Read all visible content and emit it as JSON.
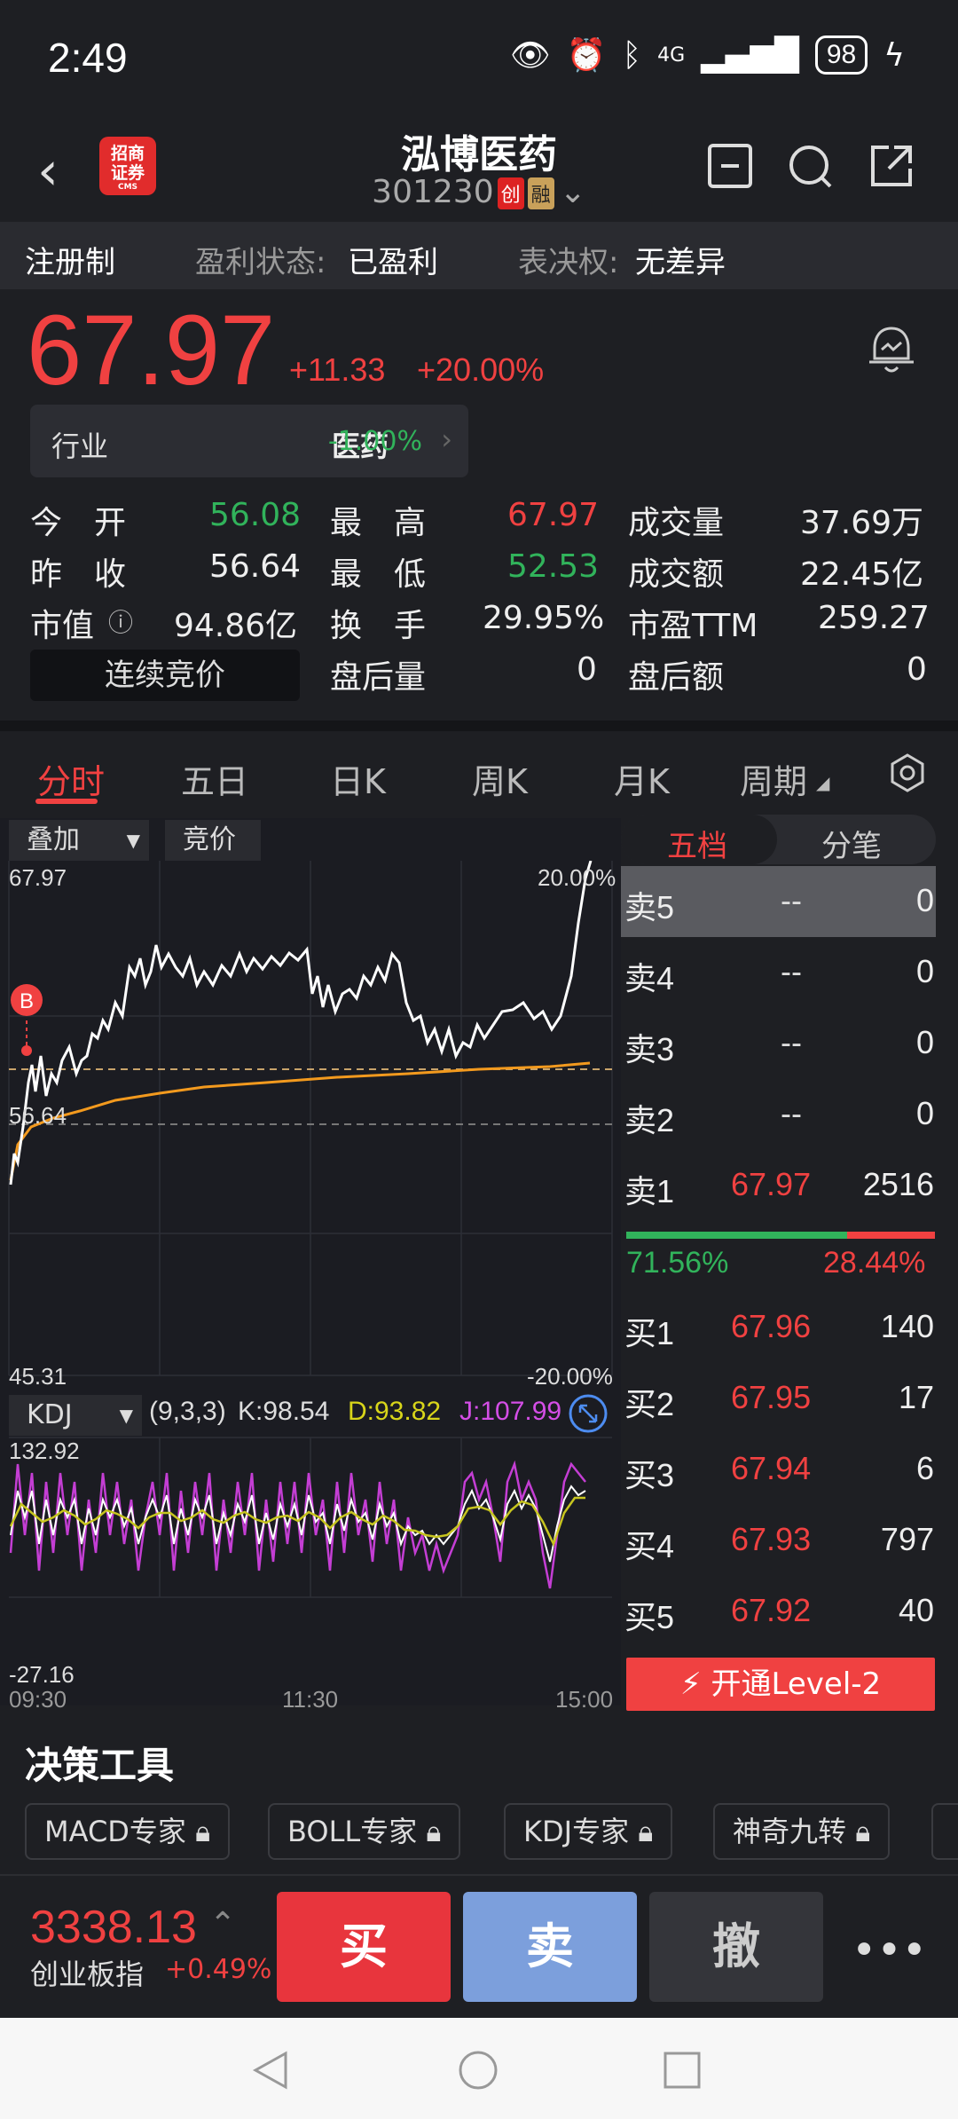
{
  "status": {
    "time": "2:49",
    "battery": "98",
    "network": "4G"
  },
  "header": {
    "name": "泓博医药",
    "code": "301230",
    "tag_cy": "创",
    "tag_rz": "融",
    "logo_line1": "招商",
    "logo_line2": "证券",
    "logo_line3": "CMS"
  },
  "strip": {
    "reg": "注册制",
    "profit_label": "盈利状态:",
    "profit_value": "已盈利",
    "vote_label": "表决权:",
    "vote_value": "无差异"
  },
  "quote": {
    "price": "67.97",
    "change": "+11.33",
    "change_pct": "+20.00%"
  },
  "industry": {
    "label": "行业",
    "name": "医药",
    "pct": "-1.00%"
  },
  "stats": {
    "open_label": "今　开",
    "open": "56.08",
    "high_label": "最　高",
    "high": "67.97",
    "vol_label": "成交量",
    "vol": "37.69万",
    "prev_label": "昨　收",
    "prev": "56.64",
    "low_label": "最　低",
    "low": "52.53",
    "amt_label": "成交额",
    "amt": "22.45亿",
    "mcap_label": "市值",
    "mcap": "94.86亿",
    "turn_label": "换　手",
    "turn": "29.95%",
    "pe_label": "市盈TTM",
    "pe": "259.27",
    "auction": "连续竞价",
    "after_vol_label": "盘后量",
    "after_vol": "0",
    "after_amt_label": "盘后额",
    "after_amt": "0"
  },
  "tabs": [
    "分时",
    "五日",
    "日K",
    "周K",
    "月K",
    "周期"
  ],
  "chart": {
    "overlay": "叠加",
    "auction": "竞价",
    "top_price": "67.97",
    "top_pct": "20.00%",
    "mid_price": "56.64",
    "bottom_price": "45.31",
    "bottom_pct": "-20.00%",
    "kdj_label": "KDJ",
    "kdj_params": "(9,3,3)",
    "k": "K:98.54",
    "d": "D:93.82",
    "j": "J:107.99",
    "kdj_max": "132.92",
    "kdj_min": "-27.16",
    "time_start": "09:30",
    "time_mid": "11:30",
    "time_end": "15:00",
    "buy_marker": "B"
  },
  "orderbook": {
    "tab1": "五档",
    "tab2": "分笔",
    "asks": [
      {
        "label": "卖5",
        "price": "--",
        "vol": "0"
      },
      {
        "label": "卖4",
        "price": "--",
        "vol": "0"
      },
      {
        "label": "卖3",
        "price": "--",
        "vol": "0"
      },
      {
        "label": "卖2",
        "price": "--",
        "vol": "0"
      },
      {
        "label": "卖1",
        "price": "67.97",
        "vol": "2516"
      }
    ],
    "buy_ratio": "71.56%",
    "sell_ratio": "28.44%",
    "bids": [
      {
        "label": "买1",
        "price": "67.96",
        "vol": "140"
      },
      {
        "label": "买2",
        "price": "67.95",
        "vol": "17"
      },
      {
        "label": "买3",
        "price": "67.94",
        "vol": "6"
      },
      {
        "label": "买4",
        "price": "67.93",
        "vol": "797"
      },
      {
        "label": "买5",
        "price": "67.92",
        "vol": "40"
      }
    ],
    "level2": "开通Level-2"
  },
  "tools": {
    "title": "决策工具",
    "items": [
      "MACD专家",
      "BOLL专家",
      "KDJ专家",
      "神奇九转"
    ]
  },
  "trade": {
    "index_value": "3338.13",
    "index_name": "创业板指",
    "index_pct": "+0.49%",
    "buy": "买",
    "sell": "卖",
    "cancel": "撤",
    "more": "•••"
  },
  "colors": {
    "up": "#f04141",
    "down": "#31b35b",
    "accent": "#f04141",
    "price_line": "#ffffff",
    "avg_line": "#f39a1e"
  }
}
